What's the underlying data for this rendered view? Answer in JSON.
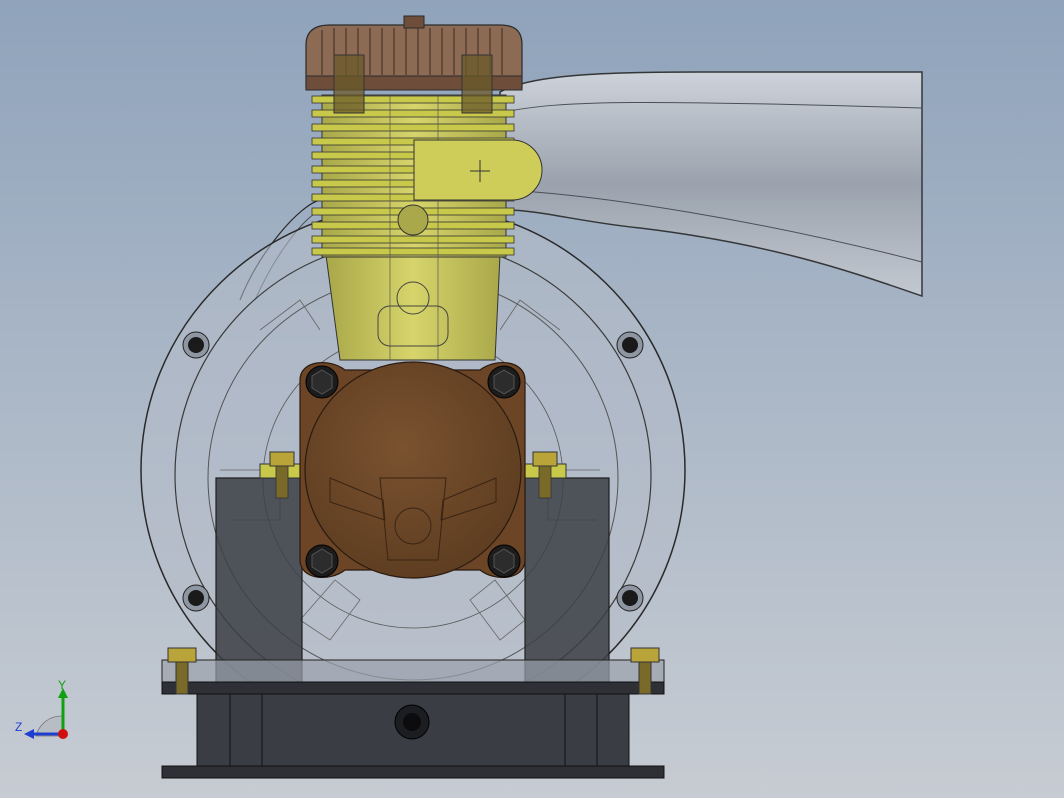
{
  "viewport": {
    "background_top": "#8fa3bb",
    "background_bottom": "#c7ccd3"
  },
  "colors": {
    "cylinder": "#c8c84a",
    "head": "#7a5a44",
    "crankcase_cover": "#6b4526",
    "bracket": "#3c3f45",
    "base": "#2e3036",
    "housing_edge": "#2a2a2a",
    "brass_bolt": "#b9a43a"
  },
  "triad": {
    "y_label": "Y",
    "z_label": "Z",
    "y_color": "#11a011",
    "z_color": "#1f3fd0",
    "x_color": "#d01010"
  }
}
